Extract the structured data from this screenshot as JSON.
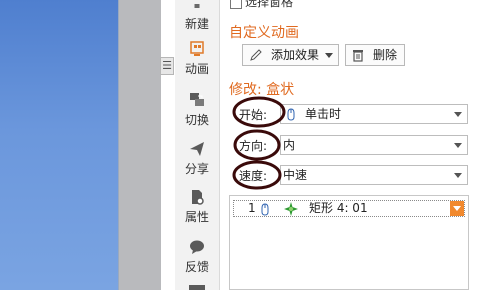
{
  "sidebar": {
    "items": [
      {
        "label": "新建",
        "icon": "new-icon"
      },
      {
        "label": "动画",
        "icon": "animation-icon"
      },
      {
        "label": "切换",
        "icon": "transition-icon"
      },
      {
        "label": "分享",
        "icon": "share-icon"
      },
      {
        "label": "属性",
        "icon": "properties-icon"
      },
      {
        "label": "反馈",
        "icon": "feedback-icon"
      }
    ],
    "collapse_glyph": "☰"
  },
  "panel": {
    "top_partial_text": "选择窗格",
    "custom_animation_title": "自定义动画",
    "add_effect_label": "添加效果",
    "delete_label": "删除",
    "modify_title": "修改: 盒状",
    "start_label": "开始:",
    "start_value": "单击时",
    "direction_label": "方向:",
    "direction_value": "内",
    "speed_label": "速度:",
    "speed_value": "中速",
    "list": [
      {
        "index": "1",
        "name": "矩形 4: 01"
      }
    ]
  },
  "colors": {
    "accent_orange": "#e06a20",
    "dropdown_orange": "#f1892e",
    "annotation_dark_red": "#3a0a0a"
  }
}
